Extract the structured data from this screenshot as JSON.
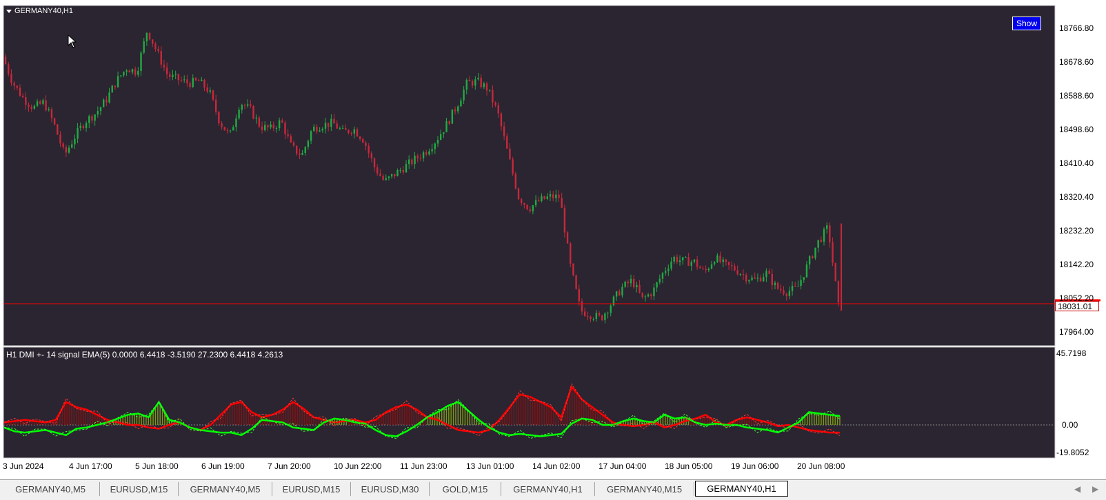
{
  "chart": {
    "symbol_title": "GERMANY40,H1",
    "show_button": "Show",
    "indicator_title": "H1 DMI +- 14  signal EMA(5)  0.0000 6.4418 -3.5190 27.2300 6.4418 4.2613",
    "current_price": "18031.01",
    "price_axis_labels": [
      "18766.80",
      "18678.60",
      "18588.60",
      "18498.60",
      "18410.40",
      "18320.40",
      "18232.20",
      "18142.20",
      "18052.20",
      "17964.00"
    ],
    "indicator_axis_labels": [
      "45.7198",
      "0.00",
      "-19.8052"
    ],
    "time_axis_labels": [
      "3 Jun 2024",
      "4 Jun 17:00",
      "5 Jun 18:00",
      "6 Jun 19:00",
      "7 Jun 20:00",
      "10 Jun 22:00",
      "11 Jun 23:00",
      "13 Jun 01:00",
      "14 Jun 02:00",
      "17 Jun 04:00",
      "18 Jun 05:00",
      "19 Jun 06:00",
      "20 Jun 08:00"
    ],
    "colors": {
      "background": "#2a2530",
      "bull_candle": "#22aa44",
      "bear_candle": "#c8283c",
      "plus_di": "#00ff00",
      "minus_di": "#ff0000",
      "price_line": "#ff0000",
      "show_button": "#0000ee"
    }
  },
  "price_path": [
    18690,
    18620,
    18580,
    18555,
    18570,
    18510,
    18430,
    18480,
    18520,
    18540,
    18575,
    18625,
    18660,
    18650,
    18760,
    18700,
    18640,
    18630,
    18620,
    18625,
    18600,
    18520,
    18480,
    18570,
    18550,
    18505,
    18500,
    18520,
    18450,
    18430,
    18500,
    18510,
    18515,
    18490,
    18500,
    18470,
    18400,
    18360,
    18380,
    18400,
    18420,
    18440,
    18470,
    18510,
    18560,
    18620,
    18625,
    18605,
    18540,
    18430,
    18320,
    18290,
    18310,
    18320,
    18320,
    18140,
    18020,
    18010,
    18000,
    18040,
    18080,
    18100,
    18050,
    18070,
    18120,
    18160,
    18150,
    18150,
    18120,
    18160,
    18140,
    18130,
    18110,
    18100,
    18120,
    18080,
    18070,
    18080,
    18140,
    18200,
    18240,
    18031
  ],
  "dmi": {
    "plus": [
      -2,
      -5,
      -6,
      -5,
      -4,
      -6,
      -8,
      -3,
      -2,
      0,
      2,
      5,
      8,
      9,
      6,
      18,
      4,
      2,
      -2,
      -4,
      -5,
      -6,
      -6,
      -8,
      -3,
      4,
      3,
      2,
      -2,
      -3,
      -4,
      2,
      5,
      4,
      2,
      1,
      -4,
      -8,
      -9,
      -5,
      0,
      6,
      10,
      15,
      18,
      11,
      4,
      -2,
      -6,
      -8,
      -7,
      -8,
      -9,
      -8,
      -7,
      1,
      5,
      4,
      0,
      0,
      3,
      5,
      3,
      2,
      8,
      5,
      6,
      2,
      0,
      1,
      0,
      0,
      -2,
      -3,
      -4,
      -6,
      -2,
      2,
      10,
      9,
      8,
      7
    ],
    "minus": [
      2,
      3,
      4,
      3,
      2,
      4,
      18,
      14,
      12,
      8,
      4,
      2,
      0,
      0,
      -2,
      -3,
      0,
      2,
      -2,
      -4,
      0,
      8,
      16,
      18,
      10,
      6,
      8,
      12,
      18,
      13,
      6,
      4,
      2,
      3,
      4,
      2,
      4,
      10,
      14,
      16,
      12,
      6,
      4,
      0,
      -4,
      -5,
      -6,
      -4,
      4,
      14,
      24,
      22,
      18,
      14,
      6,
      30,
      20,
      14,
      8,
      2,
      0,
      -1,
      0,
      2,
      -2,
      0,
      3,
      5,
      8,
      2,
      0,
      4,
      6,
      4,
      2,
      -1,
      0,
      -2,
      -4,
      -5,
      -6,
      -6
    ]
  },
  "tabs": [
    {
      "label": "GERMANY40,M5",
      "active": false
    },
    {
      "label": "EURUSD,M15",
      "active": false
    },
    {
      "label": "GERMANY40,M5",
      "active": false
    },
    {
      "label": "EURUSD,M15",
      "active": false
    },
    {
      "label": "EURUSD,M30",
      "active": false
    },
    {
      "label": "GOLD,M15",
      "active": false
    },
    {
      "label": "GERMANY40,H1",
      "active": false
    },
    {
      "label": "GERMANY40,M15",
      "active": false
    },
    {
      "label": "GERMANY40,H1",
      "active": true
    }
  ],
  "tab_scroll": {
    "left": "◀",
    "right": "▶"
  }
}
